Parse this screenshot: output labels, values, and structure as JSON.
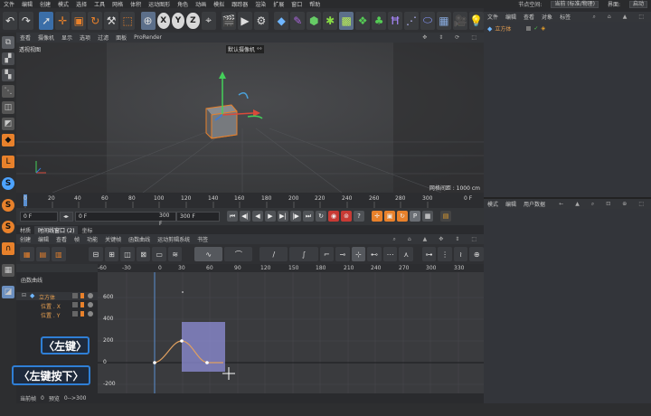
{
  "menubar": {
    "items": [
      "文件",
      "编辑",
      "创建",
      "模式",
      "选择",
      "工具",
      "网格",
      "体积",
      "运动图形",
      "角色",
      "动画",
      "模拟",
      "跟踪器",
      "渲染",
      "扩展",
      "窗口",
      "帮助"
    ],
    "node_space_label": "节点空间:",
    "node_space_value": "当前 (标准/物理)",
    "interface_label": "界面:",
    "interface_value": "启动"
  },
  "toolbar": {
    "undo_icon": "undo-icon",
    "redo_icon": "redo-icon",
    "x_label": "X",
    "y_label": "Y",
    "z_label": "Z"
  },
  "viewport": {
    "menu": [
      "查看",
      "摄像机",
      "显示",
      "选项",
      "过滤",
      "面板",
      "ProRender"
    ],
    "name": "透视视图",
    "camera": "默认摄像机 °°",
    "grid_info": "网格间距 : 1000 cm"
  },
  "timeline": {
    "ticks": [
      "0",
      "20",
      "40",
      "60",
      "80",
      "100",
      "120",
      "140",
      "160",
      "180",
      "200",
      "220",
      "240",
      "260",
      "280",
      "300"
    ],
    "end_label": "0 F"
  },
  "transport": {
    "current_frame": "0 F",
    "min_frame": "0 F",
    "max_frame": "300 F",
    "max_frame2": "300 F"
  },
  "tabs": {
    "materials": "材质",
    "timeline": "时间线窗口 (2)",
    "fullscreen": "坐标"
  },
  "tl_menu": [
    "创建",
    "编辑",
    "查看",
    "帧",
    "功能",
    "关键帧",
    "函数曲线",
    "运动剪辑系统",
    "书签"
  ],
  "graph_ruler": [
    "0",
    "30",
    "60",
    "90",
    "120",
    "150",
    "180",
    "210",
    "240",
    "270",
    "300",
    "330"
  ],
  "graph_ruler_neg": [
    "-60",
    "-30"
  ],
  "graph_yaxis": [
    "600",
    "400",
    "200",
    "0",
    "-200"
  ],
  "objects": {
    "header": "函数曲线",
    "cube": "立方体",
    "track_x": "位置 . X",
    "track_y": "位置 . Y"
  },
  "status": {
    "current": "当前帧",
    "current_val": "0",
    "preview": "预览",
    "preview_val": "0-->300"
  },
  "obj_manager": {
    "menu": [
      "文件",
      "编辑",
      "查看",
      "对象",
      "标签"
    ],
    "object": "立方体"
  },
  "attr_manager": {
    "menu": [
      "模式",
      "编辑",
      "用户数据"
    ]
  },
  "callouts": {
    "left_click": "〈左键〉",
    "left_hold": "〈左键按下〉"
  },
  "colors": {
    "accent_blue": "#2f7fd6",
    "curve_orange": "#e0a060",
    "selection": "#8f8fd8",
    "key_orange": "#e8812b"
  }
}
